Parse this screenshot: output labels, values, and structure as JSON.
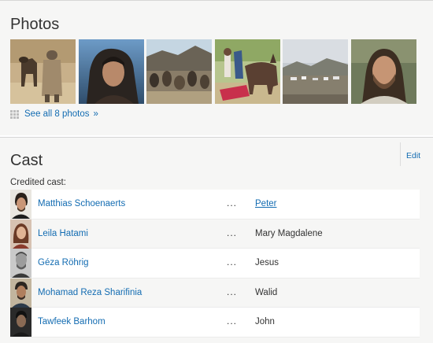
{
  "photos": {
    "title": "Photos",
    "thumbnails": [
      {
        "icon": "photo-man-with-donkey"
      },
      {
        "icon": "photo-closeup-long-hair"
      },
      {
        "icon": "photo-seated-crowd"
      },
      {
        "icon": "photo-donkey-on-cloth"
      },
      {
        "icon": "photo-desert-camp"
      },
      {
        "icon": "photo-bearded-portrait"
      }
    ],
    "see_all_label": "See all 8 photos",
    "see_all_suffix": "»"
  },
  "cast": {
    "title": "Cast",
    "edit_label": "Edit",
    "credited_label": "Credited cast:",
    "ellipsis": "...",
    "members": [
      {
        "actor": "Matthias Schoenaerts",
        "character": "Peter",
        "character_is_link": true
      },
      {
        "actor": "Leila Hatami",
        "character": "Mary Magdalene",
        "character_is_link": false
      },
      {
        "actor": "Géza Röhrig",
        "character": "Jesus",
        "character_is_link": false
      },
      {
        "actor": "Mohamad Reza Sharifinia",
        "character": "Walid",
        "character_is_link": false
      },
      {
        "actor": "Tawfeek Barhom",
        "character": "John",
        "character_is_link": false
      }
    ]
  },
  "colors": {
    "link": "#136cb2",
    "text": "#333333",
    "section_bg": "#f6f6f5"
  }
}
